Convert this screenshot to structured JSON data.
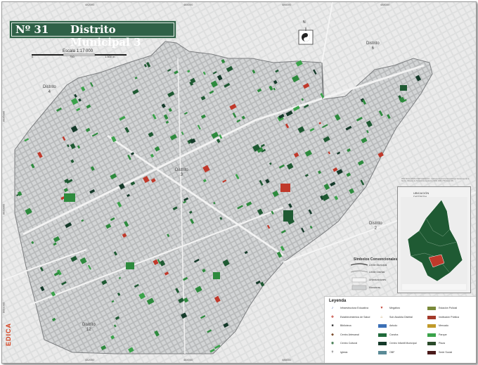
{
  "title": {
    "number": "Nº 31",
    "name": "Distrito Municipal 3"
  },
  "scale": {
    "label": "Escala 1:17 000",
    "ticks": [
      "0",
      "750",
      "1.500 m"
    ]
  },
  "compass": {
    "north": "N"
  },
  "districts": [
    {
      "id": "d4",
      "label": "Distrito\n4"
    },
    {
      "id": "d6",
      "label": "Distrito\n6"
    },
    {
      "id": "d3",
      "label": "Distrito\n3"
    },
    {
      "id": "d2",
      "label": "Distrito\n2"
    },
    {
      "id": "d12",
      "label": "Distrito\n12"
    }
  ],
  "symbols": {
    "title": "Símbolos Convencionales",
    "items": [
      "Límite Municipal",
      "Límite Distrital",
      "Urbanizaciones",
      "Manzanas"
    ]
  },
  "legend": {
    "title": "Leyenda",
    "col1": [
      {
        "icon": "♪",
        "color": "#3a5aa8",
        "label": "Infraestructura Educativa"
      },
      {
        "icon": "✚",
        "color": "#c0392b",
        "label": "Establecimientos de Salud"
      },
      {
        "icon": "■",
        "color": "#333333",
        "label": "Biblioteca"
      },
      {
        "icon": "◆",
        "color": "#7a4a2a",
        "label": "Centro Artesanal"
      },
      {
        "icon": "◉",
        "color": "#2a6a3a",
        "label": "Centro Cultural"
      },
      {
        "icon": "✝",
        "color": "#555555",
        "label": "Iglesia"
      }
    ],
    "col2": [
      {
        "icon": "▼",
        "color": "#c0392b",
        "label": "Megáforo"
      },
      {
        "icon": "⌂",
        "color": "#b07a2a",
        "label": "Sub Alcaldía Distrital"
      },
      {
        "swatch": "#3b6fb6",
        "label": "Aeludo"
      },
      {
        "swatch": "#1f6a3a",
        "label": "Cancha"
      },
      {
        "swatch": "#153a2a",
        "label": "Centro Infantil Municipal"
      },
      {
        "swatch": "#5a8a96",
        "label": "OBF"
      }
    ],
    "col3": [
      {
        "swatch": "#7a8a3a",
        "label": "Estación Policial"
      },
      {
        "swatch": "#a33a2a",
        "label": "Institución Pública"
      },
      {
        "swatch": "#c09a2a",
        "label": "Mercado"
      },
      {
        "swatch": "#3aa34a",
        "label": "Parque"
      },
      {
        "swatch": "#2a4a2a",
        "label": "Plaza"
      },
      {
        "swatch": "#4a1a1a",
        "label": "Sede Social"
      }
    ]
  },
  "inset": {
    "title_line1": "UBICACIÓN",
    "title_line2": "DISTRITAL"
  },
  "credit": "PROYECTO MAPA CARTOGRÁFICO · Gobierno Autónomo Municipal de Santa Cruz de la Sierra · Sistema de Referencia Geodésico WGS 1984 UTM Zona 20S",
  "brand": "EDICA",
  "top_ticks": [
    "482000",
    "484000",
    "486000",
    "488000",
    "490000",
    "492000"
  ],
  "left_ticks": [
    "8035000",
    "8033000",
    "8031000",
    "8029000",
    "8027000"
  ],
  "colors": {
    "green": "#2e8b3e",
    "dark_green": "#1f5a33",
    "red": "#c0392b",
    "title_bg": "#2f6147"
  }
}
